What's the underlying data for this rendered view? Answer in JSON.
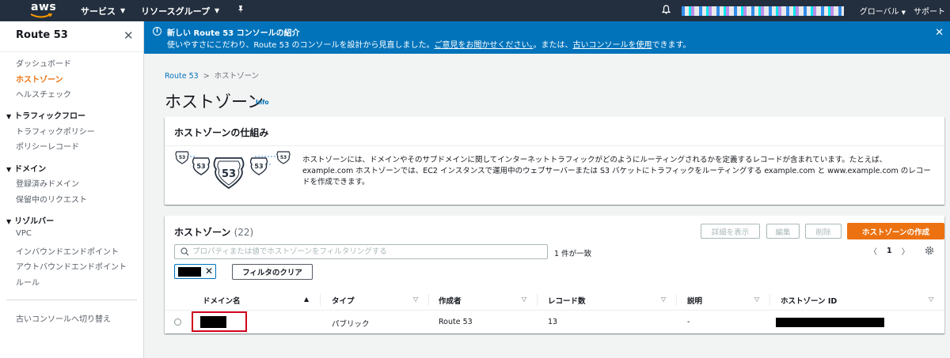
{
  "topnav": {
    "logo": "aws",
    "services": "サービス",
    "resource_groups": "リソースグループ",
    "region": "グローバル",
    "support": "サポート"
  },
  "sidebar": {
    "title": "Route 53",
    "items": [
      {
        "label": "ダッシュボード",
        "active": false
      },
      {
        "label": "ホストゾーン",
        "active": true
      },
      {
        "label": "ヘルスチェック",
        "active": false
      }
    ],
    "traffic_flow": {
      "title": "トラフィックフロー",
      "items": [
        "トラフィックポリシー",
        "ポリシーレコード"
      ]
    },
    "domains": {
      "title": "ドメイン",
      "items": [
        "登録済みドメイン",
        "保留中のリクエスト"
      ]
    },
    "resolver": {
      "title": "リゾルバー",
      "items": [
        "VPC",
        "インバウンドエンドポイント",
        "アウトバウンドエンドポイント",
        "ルール"
      ]
    },
    "old_console": "古いコンソールへ切り替え"
  },
  "banner": {
    "title": "新しい Route 53 コンソールの紹介",
    "text_1": "使いやすさにこだわり、Route 53 のコンソールを設計から見直しました。",
    "link_1": "ご意見をお聞かせください。",
    "text_2": "。または、",
    "link_2": "古いコンソールを使用",
    "text_3": "できます。"
  },
  "breadcrumb": {
    "root": "Route 53",
    "current": "ホストゾーン"
  },
  "page": {
    "title": "ホストゾーン",
    "info": "Info"
  },
  "how_it_works": {
    "title": "ホストゾーンの仕組み",
    "shield_label": "53",
    "text": "ホストゾーンには、ドメインやそのサブドメインに関してインターネットトラフィックがどのようにルーティングされるかを定義するレコードが含まれています。たとえば、example.com ホストゾーンでは、EC2 インスタンスで運用中のウェブサーバーまたは S3 バケットにトラフィックをルーティングする example.com と www.example.com のレコードを作成できます。"
  },
  "hosted_zones": {
    "title": "ホストゾーン",
    "count": "(22)",
    "buttons": {
      "details": "詳細を表示",
      "edit": "編集",
      "delete": "削除",
      "create": "ホストゾーンの作成"
    },
    "search_placeholder": "プロパティまたは値でホストゾーンをフィルタリングする",
    "match_text": "1 件が一致",
    "page_number": "1",
    "clear_filter": "フィルタのクリア",
    "columns": [
      "ドメイン名",
      "タイプ",
      "作成者",
      "レコード数",
      "説明",
      "ホストゾーン ID"
    ],
    "rows": [
      {
        "domain": "",
        "type": "パブリック",
        "created_by": "Route 53",
        "record_count": "13",
        "description": "-",
        "zone_id": ""
      }
    ]
  }
}
